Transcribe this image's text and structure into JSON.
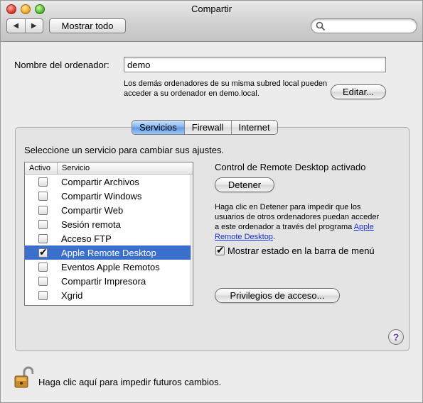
{
  "window": {
    "title": "Compartir"
  },
  "toolbar": {
    "back_glyph": "◀",
    "forward_glyph": "▶",
    "show_all_label": "Mostrar todo",
    "search_placeholder": ""
  },
  "computer_name": {
    "label": "Nombre del ordenador:",
    "value": "demo",
    "help": "Los demás ordenadores de su misma subred local pueden acceder a su ordenador en demo.local.",
    "edit_label": "Editar..."
  },
  "tabs": [
    {
      "label": "Servicios",
      "active": true
    },
    {
      "label": "Firewall",
      "active": false
    },
    {
      "label": "Internet",
      "active": false
    }
  ],
  "instructions": "Seleccione un servicio para cambiar sus ajustes.",
  "services": {
    "columns": [
      "Activo",
      "Servicio"
    ],
    "rows": [
      {
        "name": "Compartir Archivos",
        "checked": false
      },
      {
        "name": "Compartir Windows",
        "checked": false
      },
      {
        "name": "Compartir Web",
        "checked": false
      },
      {
        "name": "Sesión remota",
        "checked": false
      },
      {
        "name": "Acceso FTP",
        "checked": false
      },
      {
        "name": "Apple Remote Desktop",
        "checked": true,
        "selected": true
      },
      {
        "name": "Eventos Apple Remotos",
        "checked": false
      },
      {
        "name": "Compartir Impresora",
        "checked": false
      },
      {
        "name": "Xgrid",
        "checked": false
      }
    ]
  },
  "detail": {
    "status": "Control de Remote Desktop activado",
    "stop_label": "Detener",
    "help_text": "Haga clic en Detener para impedir que los usuarios de otros ordenadores puedan acceder a este ordenador a través del programa",
    "help_link": "Apple Remote Desktop",
    "help_end": ".",
    "menu_checkbox_label": "Mostrar estado en la barra de menú",
    "menu_checkbox_checked": true,
    "privileges_label": "Privilegios de acceso...",
    "help_button": "?"
  },
  "footer": {
    "lock_icon": "lock-open-icon",
    "lock_label": "Haga clic aquí para impedir futuros cambios."
  }
}
